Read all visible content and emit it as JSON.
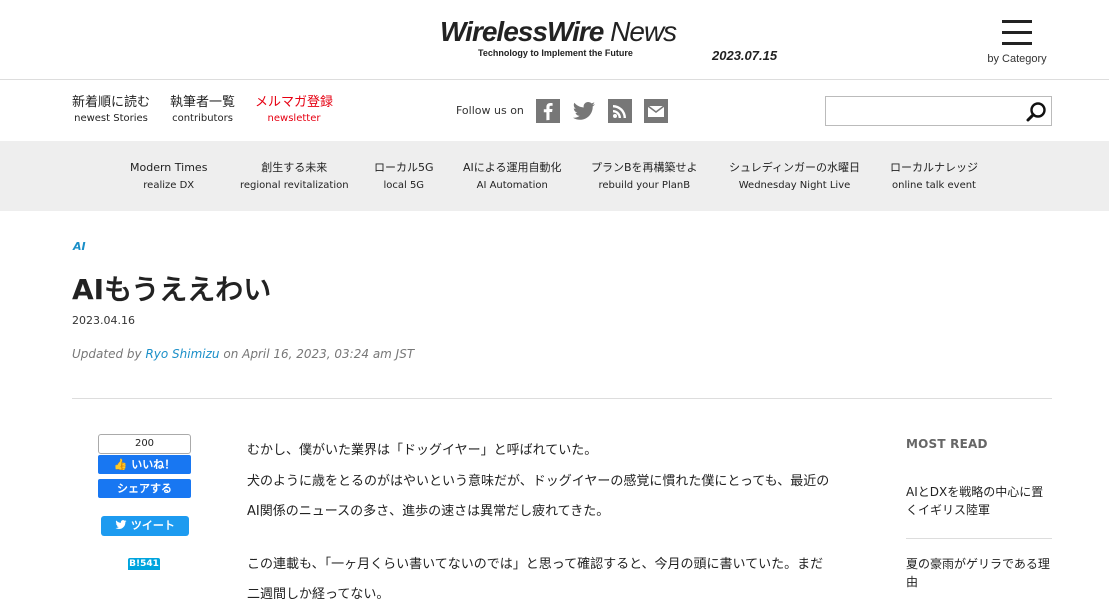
{
  "header": {
    "logo_part1": "Wireless",
    "logo_part2": "Wire",
    "logo_part3": " News",
    "logo_tagline": "Technology to Implement the Future",
    "date": "2023.07.15",
    "menu_caption": "by Category"
  },
  "subnav": {
    "links": [
      {
        "jp": "新着順に読む",
        "en": "newest Stories"
      },
      {
        "jp": "執筆者一覧",
        "en": "contributors"
      },
      {
        "jp": "メルマガ登録",
        "en": "newsletter"
      }
    ],
    "follow_label": "Follow us on",
    "social_icons": [
      "facebook-icon",
      "twitter-icon",
      "rss-icon",
      "mail-icon"
    ],
    "search_placeholder": "",
    "newsletter_color": "#e60012"
  },
  "categories": [
    {
      "jp": "Modern Times",
      "en": "realize DX"
    },
    {
      "jp": "創生する未来",
      "en": "regional revitalization"
    },
    {
      "jp": "ローカル5G",
      "en": "local 5G"
    },
    {
      "jp": "AIによる運用自動化",
      "en": "AI Automation"
    },
    {
      "jp": "プランBを再構築せよ",
      "en": "rebuild your PlanB"
    },
    {
      "jp": "シュレディンガーの水曜日",
      "en": "Wednesday Night Live"
    },
    {
      "jp": "ローカルナレッジ",
      "en": "online talk event"
    }
  ],
  "article": {
    "category": "AI",
    "title": "AIもうええわい",
    "date": "2023.04.16",
    "updated_prefix": "Updated by ",
    "author": "Ryo Shimizu",
    "updated_suffix": " on April 16, 2023, 03:24 am JST",
    "paragraphs": [
      [
        "むかし、僕がいた業界は「ドッグイヤー」と呼ばれていた。",
        "犬のように歳をとるのがはやいという意味だが、ドッグイヤーの感覚に慣れた僕にとっても、最近の",
        "AI関係のニュースの多さ、進歩の速さは異常だし疲れてきた。"
      ],
      [
        "この連載も、「一ヶ月くらい書いてないのでは」と思って確認すると、今月の頭に書いていた。まだ",
        "二週間しか経ってない。"
      ]
    ],
    "accent_color": "#1a8fc8"
  },
  "share": {
    "fb_count": "200",
    "fb_like": "いいね！",
    "fb_share": "シェアする",
    "tweet": "ツイート",
    "hatena": "B!541"
  },
  "most_read": {
    "title": "MOST READ",
    "items": [
      "AIとDXを戦略の中心に置くイギリス陸軍",
      "夏の豪雨がゲリラである理由"
    ]
  }
}
